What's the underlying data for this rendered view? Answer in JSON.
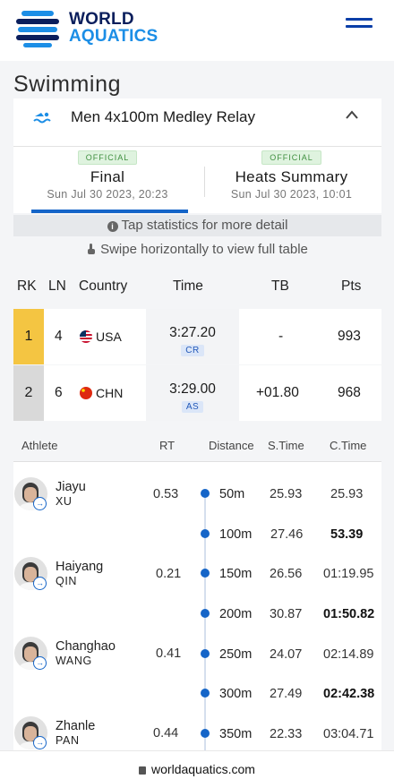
{
  "brand": {
    "line1": "WORLD",
    "line2": "AQUATICS"
  },
  "page": {
    "title": "Swimming"
  },
  "event": {
    "name": "Men 4x100m Medley Relay"
  },
  "tabs": [
    {
      "badge": "OFFICIAL",
      "label": "Final",
      "date": "Sun Jul 30 2023, 20:23"
    },
    {
      "badge": "OFFICIAL",
      "label": "Heats Summary",
      "date": "Sun Jul 30 2023, 10:01"
    }
  ],
  "info": {
    "tap": "Tap statistics for more detail",
    "swipe": "Swipe horizontally to view full table"
  },
  "results": {
    "headers": {
      "rk": "RK",
      "ln": "LN",
      "country": "Country",
      "time": "Time",
      "tb": "TB",
      "pts": "Pts"
    },
    "rows": [
      {
        "rk": "1",
        "ln": "4",
        "country": "USA",
        "time": "3:27.20",
        "record": "CR",
        "tb": "-",
        "pts": "993"
      },
      {
        "rk": "2",
        "ln": "6",
        "country": "CHN",
        "time": "3:29.00",
        "record": "AS",
        "tb": "+01.80",
        "pts": "968"
      }
    ]
  },
  "splits": {
    "headers": {
      "athlete": "Athlete",
      "rt": "RT",
      "distance": "Distance",
      "stime": "S.Time",
      "ctime": "C.Time"
    },
    "athletes": [
      {
        "first": "Jiayu",
        "last": "XU",
        "rt": "0.53"
      },
      {
        "first": "Haiyang",
        "last": "QIN",
        "rt": "0.21"
      },
      {
        "first": "Changhao",
        "last": "WANG",
        "rt": "0.41"
      },
      {
        "first": "Zhanle",
        "last": "PAN",
        "rt": "0.44"
      }
    ],
    "rows": [
      {
        "distance": "50m",
        "stime": "25.93",
        "ctime": "25.93"
      },
      {
        "distance": "100m",
        "stime": "27.46",
        "ctime": "53.39"
      },
      {
        "distance": "150m",
        "stime": "26.56",
        "ctime": "01:19.95"
      },
      {
        "distance": "200m",
        "stime": "30.87",
        "ctime": "01:50.82"
      },
      {
        "distance": "250m",
        "stime": "24.07",
        "ctime": "02:14.89"
      },
      {
        "distance": "300m",
        "stime": "27.49",
        "ctime": "02:42.38"
      },
      {
        "distance": "350m",
        "stime": "22.33",
        "ctime": "03:04.71"
      }
    ]
  },
  "browser": {
    "url": "worldaquatics.com"
  },
  "colors": {
    "gold": "#f4c542",
    "silver": "#d9d9d9",
    "accent": "#1565c8",
    "brand_dark": "#0a1e5c",
    "brand_light": "#1c8ee6"
  }
}
